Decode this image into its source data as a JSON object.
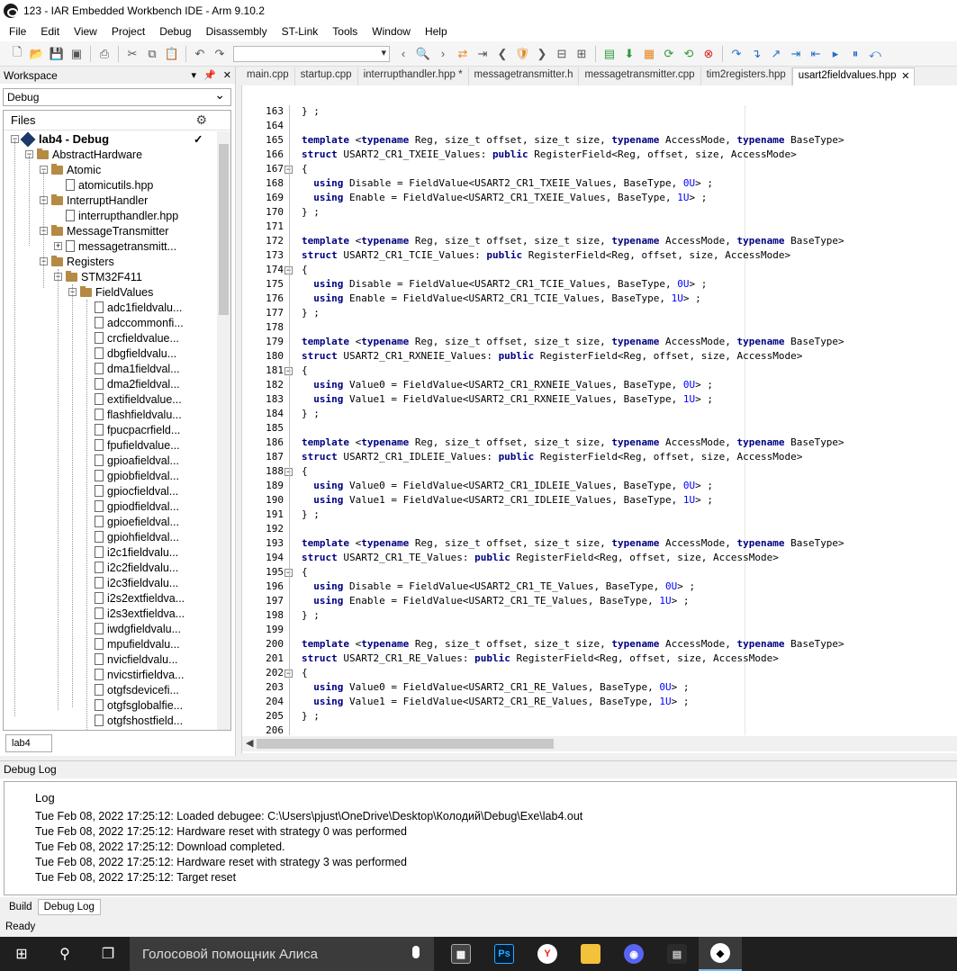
{
  "window": {
    "title": "123 - IAR Embedded Workbench IDE - Arm 9.10.2"
  },
  "menu": [
    "File",
    "Edit",
    "View",
    "Project",
    "Debug",
    "Disassembly",
    "ST-Link",
    "Tools",
    "Window",
    "Help"
  ],
  "workspace": {
    "header": "Workspace",
    "config": "Debug",
    "files_label": "Files",
    "tab_label": "lab4",
    "tree": [
      {
        "label": "lab4 - Debug",
        "kind": "project",
        "level": 0,
        "toggle": "−",
        "bold": true
      },
      {
        "label": "AbstractHardware",
        "kind": "folder",
        "level": 1,
        "toggle": "−"
      },
      {
        "label": "Atomic",
        "kind": "folder",
        "level": 2,
        "toggle": "−"
      },
      {
        "label": "atomicutils.hpp",
        "kind": "file",
        "level": 3
      },
      {
        "label": "InterruptHandler",
        "kind": "folder",
        "level": 2,
        "toggle": "−"
      },
      {
        "label": "interrupthandler.hpp",
        "kind": "file",
        "level": 3
      },
      {
        "label": "MessageTransmitter",
        "kind": "folder",
        "level": 2,
        "toggle": "−"
      },
      {
        "label": "messagetransmitt...",
        "kind": "file",
        "level": 3,
        "toggle": "+"
      },
      {
        "label": "Registers",
        "kind": "folder",
        "level": 2,
        "toggle": "−"
      },
      {
        "label": "STM32F411",
        "kind": "folder",
        "level": 3,
        "toggle": "−"
      },
      {
        "label": "FieldValues",
        "kind": "folder",
        "level": 4,
        "toggle": "−"
      },
      {
        "label": "adc1fieldvalu...",
        "kind": "file",
        "level": 5
      },
      {
        "label": "adccommonfi...",
        "kind": "file",
        "level": 5
      },
      {
        "label": "crcfieldvalue...",
        "kind": "file",
        "level": 5
      },
      {
        "label": "dbgfieldvalu...",
        "kind": "file",
        "level": 5
      },
      {
        "label": "dma1fieldval...",
        "kind": "file",
        "level": 5
      },
      {
        "label": "dma2fieldval...",
        "kind": "file",
        "level": 5
      },
      {
        "label": "extifieldvalue...",
        "kind": "file",
        "level": 5
      },
      {
        "label": "flashfieldvalu...",
        "kind": "file",
        "level": 5
      },
      {
        "label": "fpucpacrfield...",
        "kind": "file",
        "level": 5
      },
      {
        "label": "fpufieldvalue...",
        "kind": "file",
        "level": 5
      },
      {
        "label": "gpioafieldval...",
        "kind": "file",
        "level": 5
      },
      {
        "label": "gpiobfieldval...",
        "kind": "file",
        "level": 5
      },
      {
        "label": "gpiocfieldval...",
        "kind": "file",
        "level": 5
      },
      {
        "label": "gpiodfieldval...",
        "kind": "file",
        "level": 5
      },
      {
        "label": "gpioefieldval...",
        "kind": "file",
        "level": 5
      },
      {
        "label": "gpiohfieldval...",
        "kind": "file",
        "level": 5
      },
      {
        "label": "i2c1fieldvalu...",
        "kind": "file",
        "level": 5
      },
      {
        "label": "i2c2fieldvalu...",
        "kind": "file",
        "level": 5
      },
      {
        "label": "i2c3fieldvalu...",
        "kind": "file",
        "level": 5
      },
      {
        "label": "i2s2extfieldva...",
        "kind": "file",
        "level": 5
      },
      {
        "label": "i2s3extfieldva...",
        "kind": "file",
        "level": 5
      },
      {
        "label": "iwdgfieldvalu...",
        "kind": "file",
        "level": 5
      },
      {
        "label": "mpufieldvalu...",
        "kind": "file",
        "level": 5
      },
      {
        "label": "nvicfieldvalu...",
        "kind": "file",
        "level": 5
      },
      {
        "label": "nvicstirfieldva...",
        "kind": "file",
        "level": 5
      },
      {
        "label": "otgfsdevicefi...",
        "kind": "file",
        "level": 5
      },
      {
        "label": "otgfsglobalfie...",
        "kind": "file",
        "level": 5
      },
      {
        "label": "otgfshostfield...",
        "kind": "file",
        "level": 5
      }
    ]
  },
  "editor": {
    "tabs": [
      "main.cpp",
      "startup.cpp",
      "interrupthandler.hpp *",
      "messagetransmitter.h",
      "messagetransmitter.cpp",
      "tim2registers.hpp",
      "usart2fieldvalues.hpp"
    ],
    "active_tab": 6,
    "close_glyph": "✕",
    "lines": [
      {
        "n": "163",
        "text": "} ;"
      },
      {
        "n": "164",
        "text": ""
      },
      {
        "n": "165",
        "text": "template <typename Reg, size_t offset, size_t size, typename AccessMode, typename BaseType>"
      },
      {
        "n": "166",
        "text": "struct USART2_CR1_TXEIE_Values: public RegisterField<Reg, offset, size, AccessMode>"
      },
      {
        "n": "167",
        "text": "{",
        "fold": "−"
      },
      {
        "n": "168",
        "text": "  using Disable = FieldValue<USART2_CR1_TXEIE_Values, BaseType, 0U> ;"
      },
      {
        "n": "169",
        "text": "  using Enable = FieldValue<USART2_CR1_TXEIE_Values, BaseType, 1U> ;"
      },
      {
        "n": "170",
        "text": "} ;"
      },
      {
        "n": "171",
        "text": ""
      },
      {
        "n": "172",
        "text": "template <typename Reg, size_t offset, size_t size, typename AccessMode, typename BaseType>"
      },
      {
        "n": "173",
        "text": "struct USART2_CR1_TCIE_Values: public RegisterField<Reg, offset, size, AccessMode>"
      },
      {
        "n": "174",
        "text": "{",
        "fold": "−"
      },
      {
        "n": "175",
        "text": "  using Disable = FieldValue<USART2_CR1_TCIE_Values, BaseType, 0U> ;"
      },
      {
        "n": "176",
        "text": "  using Enable = FieldValue<USART2_CR1_TCIE_Values, BaseType, 1U> ;"
      },
      {
        "n": "177",
        "text": "} ;"
      },
      {
        "n": "178",
        "text": ""
      },
      {
        "n": "179",
        "text": "template <typename Reg, size_t offset, size_t size, typename AccessMode, typename BaseType>"
      },
      {
        "n": "180",
        "text": "struct USART2_CR1_RXNEIE_Values: public RegisterField<Reg, offset, size, AccessMode>"
      },
      {
        "n": "181",
        "text": "{",
        "fold": "−"
      },
      {
        "n": "182",
        "text": "  using Value0 = FieldValue<USART2_CR1_RXNEIE_Values, BaseType, 0U> ;"
      },
      {
        "n": "183",
        "text": "  using Value1 = FieldValue<USART2_CR1_RXNEIE_Values, BaseType, 1U> ;"
      },
      {
        "n": "184",
        "text": "} ;"
      },
      {
        "n": "185",
        "text": ""
      },
      {
        "n": "186",
        "text": "template <typename Reg, size_t offset, size_t size, typename AccessMode, typename BaseType>"
      },
      {
        "n": "187",
        "text": "struct USART2_CR1_IDLEIE_Values: public RegisterField<Reg, offset, size, AccessMode>"
      },
      {
        "n": "188",
        "text": "{",
        "fold": "−"
      },
      {
        "n": "189",
        "text": "  using Value0 = FieldValue<USART2_CR1_IDLEIE_Values, BaseType, 0U> ;"
      },
      {
        "n": "190",
        "text": "  using Value1 = FieldValue<USART2_CR1_IDLEIE_Values, BaseType, 1U> ;"
      },
      {
        "n": "191",
        "text": "} ;"
      },
      {
        "n": "192",
        "text": ""
      },
      {
        "n": "193",
        "text": "template <typename Reg, size_t offset, size_t size, typename AccessMode, typename BaseType>"
      },
      {
        "n": "194",
        "text": "struct USART2_CR1_TE_Values: public RegisterField<Reg, offset, size, AccessMode>"
      },
      {
        "n": "195",
        "text": "{",
        "fold": "−"
      },
      {
        "n": "196",
        "text": "  using Disable = FieldValue<USART2_CR1_TE_Values, BaseType, 0U> ;"
      },
      {
        "n": "197",
        "text": "  using Enable = FieldValue<USART2_CR1_TE_Values, BaseType, 1U> ;"
      },
      {
        "n": "198",
        "text": "} ;"
      },
      {
        "n": "199",
        "text": ""
      },
      {
        "n": "200",
        "text": "template <typename Reg, size_t offset, size_t size, typename AccessMode, typename BaseType>"
      },
      {
        "n": "201",
        "text": "struct USART2_CR1_RE_Values: public RegisterField<Reg, offset, size, AccessMode>"
      },
      {
        "n": "202",
        "text": "{",
        "fold": "−"
      },
      {
        "n": "203",
        "text": "  using Value0 = FieldValue<USART2_CR1_RE_Values, BaseType, 0U> ;"
      },
      {
        "n": "204",
        "text": "  using Value1 = FieldValue<USART2_CR1_RE_Values, BaseType, 1U> ;"
      },
      {
        "n": "205",
        "text": "} ;"
      },
      {
        "n": "206",
        "text": ""
      }
    ]
  },
  "debug_log": {
    "header": "Debug Log",
    "column": "Log",
    "lines": [
      "Tue Feb 08, 2022 17:25:12: Loaded debugee: C:\\Users\\pjust\\OneDrive\\Desktop\\Колодий\\Debug\\Exe\\lab4.out",
      "Tue Feb 08, 2022 17:25:12: Hardware reset with strategy 0 was performed",
      "Tue Feb 08, 2022 17:25:12: Download completed.",
      "Tue Feb 08, 2022 17:25:12: Hardware reset with strategy 3 was performed",
      "Tue Feb 08, 2022 17:25:12: Target reset"
    ]
  },
  "bottom_tabs": [
    "Build",
    "Debug Log"
  ],
  "status": "Ready",
  "taskbar": {
    "search_placeholder": "Голосовой помощник Алиса",
    "ps_label": "Ps",
    "yandex_label": "Y"
  },
  "colors": {
    "keyword": "#000080",
    "number": "#0000ff",
    "taskbar": "#1f1f1f",
    "accent": "#76b9ed"
  }
}
